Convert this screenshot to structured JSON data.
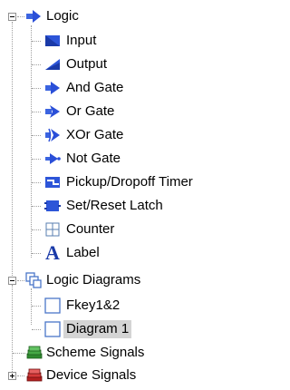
{
  "tree": {
    "logic": {
      "label": "Logic",
      "expanded": true,
      "icon": "arrow-icon",
      "children": [
        {
          "label": "Input",
          "icon": "input-icon"
        },
        {
          "label": "Output",
          "icon": "output-icon"
        },
        {
          "label": "And Gate",
          "icon": "and-gate-icon"
        },
        {
          "label": "Or Gate",
          "icon": "or-gate-icon"
        },
        {
          "label": "XOr Gate",
          "icon": "xor-gate-icon"
        },
        {
          "label": "Not Gate",
          "icon": "not-gate-icon"
        },
        {
          "label": "Pickup/Dropoff Timer",
          "icon": "timer-icon"
        },
        {
          "label": "Set/Reset Latch",
          "icon": "latch-icon"
        },
        {
          "label": "Counter",
          "icon": "counter-icon"
        },
        {
          "label": "Label",
          "icon": "label-icon"
        }
      ]
    },
    "logic_diagrams": {
      "label": "Logic Diagrams",
      "expanded": true,
      "icon": "diagrams-icon",
      "children": [
        {
          "label": "Fkey1&2",
          "icon": "document-icon"
        },
        {
          "label": "Diagram 1",
          "icon": "document-icon",
          "selected": true
        }
      ]
    },
    "scheme_signals": {
      "label": "Scheme Signals",
      "icon": "green-books-icon"
    },
    "device_signals": {
      "label": "Device Signals",
      "expanded": false,
      "icon": "red-books-icon"
    }
  },
  "colors": {
    "selection": "#d4d4d4",
    "icon_blue": "#2a4fd8",
    "connector": "#a0a0a0"
  }
}
